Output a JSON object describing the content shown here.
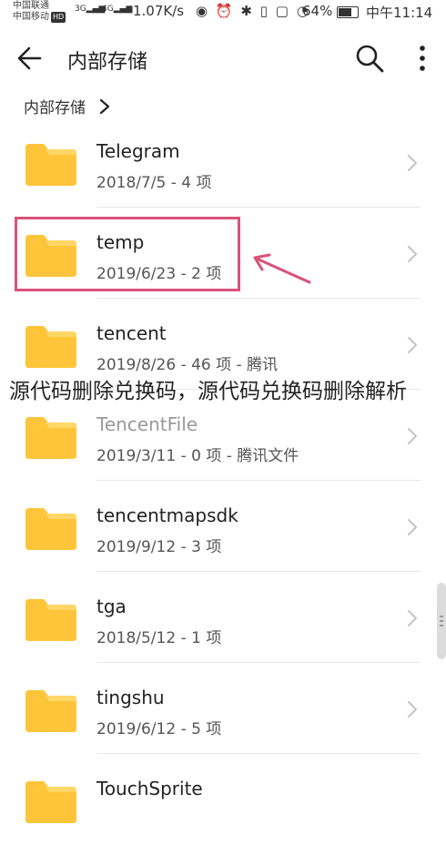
{
  "status_bar": {
    "carrier1": "中国联通",
    "carrier2": "中国移动",
    "hd": "HD",
    "sig1": "3G",
    "sig2": "4G",
    "speed": "1.07K/s",
    "battery_pct": "64%",
    "time": "中午11:14"
  },
  "app_bar": {
    "title": "内部存储"
  },
  "breadcrumb": {
    "label": "内部存储"
  },
  "folders": [
    {
      "name": "Telegram",
      "meta": "2018/7/5 - 4 项"
    },
    {
      "name": "temp",
      "meta": "2019/6/23 - 2 项"
    },
    {
      "name": "tencent",
      "meta": "2019/8/26 - 46 项 - 腾讯"
    },
    {
      "name": "TencentFile",
      "meta": "2019/3/11 - 0 项 - 腾讯文件"
    },
    {
      "name": "tencentmapsdk",
      "meta": "2019/9/12 - 3 项"
    },
    {
      "name": "tga",
      "meta": "2018/5/12 - 1 项"
    },
    {
      "name": "tingshu",
      "meta": "2019/6/12 - 5 项"
    },
    {
      "name": "TouchSprite",
      "meta": ""
    }
  ],
  "overlay": {
    "text": "源代码删除兑换码，源代码兑换码删除解析"
  },
  "colors": {
    "folder": "#FFC53A",
    "folder_tab": "#FFD766",
    "highlight": "#D9527A"
  }
}
